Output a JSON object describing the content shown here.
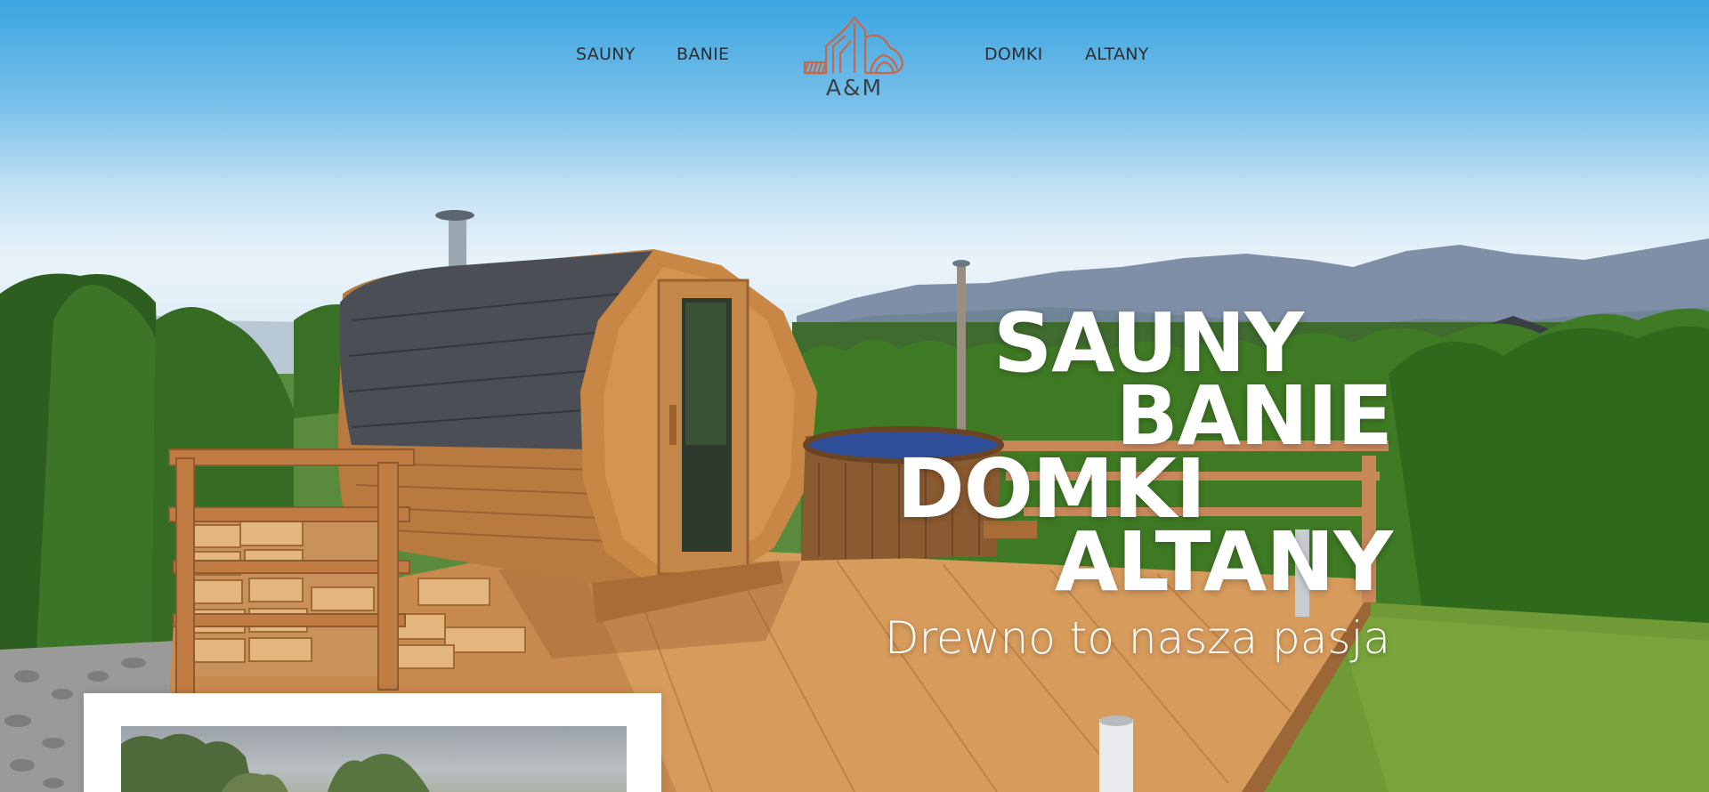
{
  "nav": {
    "left": [
      {
        "label": "SAUNY"
      },
      {
        "label": "BANIE"
      }
    ],
    "right": [
      {
        "label": "DOMKI"
      },
      {
        "label": "ALTANY"
      }
    ],
    "logo_text": "A&M"
  },
  "hero": {
    "headline": [
      "SAUNY",
      "BANIE",
      "DOMKI",
      "ALTANY"
    ],
    "tagline": "Drewno to nasza pasja"
  },
  "colors": {
    "logo": "#c8684a",
    "nav_text": "#2b2f33",
    "headline": "#ffffff",
    "sky_top": "#3aa5e0"
  }
}
